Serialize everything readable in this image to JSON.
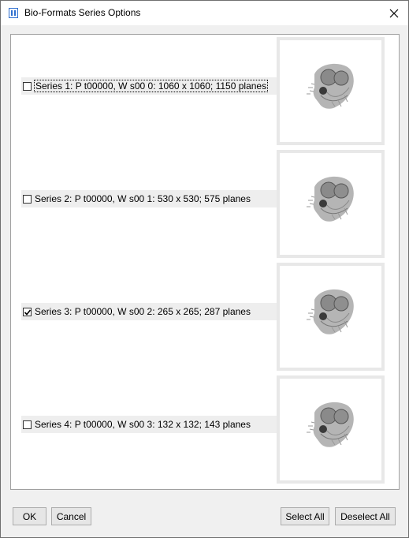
{
  "window": {
    "title": "Bio-Formats Series Options"
  },
  "series": [
    {
      "label": "Series 1: P t00000, W s00 0: 1060 x 1060; 1150 planes",
      "checked": false,
      "focused": true
    },
    {
      "label": "Series 2: P t00000, W s00 1: 530 x 530; 575 planes",
      "checked": false,
      "focused": false
    },
    {
      "label": "Series 3: P t00000, W s00 2: 265 x 265; 287 planes",
      "checked": true,
      "focused": false
    },
    {
      "label": "Series 4: P t00000, W s00 3: 132 x 132; 143 planes",
      "checked": false,
      "focused": false
    }
  ],
  "buttons": {
    "ok": "OK",
    "cancel": "Cancel",
    "select_all": "Select All",
    "deselect_all": "Deselect All"
  },
  "icons": {
    "app": "imagej-icon",
    "close": "close-icon",
    "thumbnail": "brain-slice-thumbnail"
  },
  "colors": {
    "accent": "#1f5fbf",
    "panel": "#ffffff",
    "background": "#f0f0f0"
  }
}
